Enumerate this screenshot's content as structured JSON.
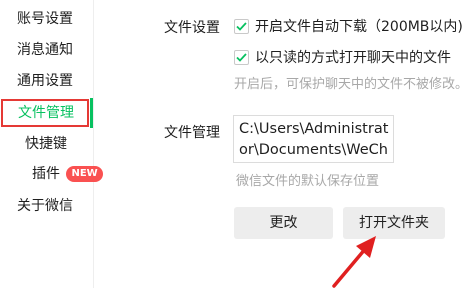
{
  "sidebar": {
    "items": [
      {
        "label": "账号设置"
      },
      {
        "label": "消息通知"
      },
      {
        "label": "通用设置"
      },
      {
        "label": "文件管理",
        "active": true
      },
      {
        "label": "快捷键"
      },
      {
        "label": "插件",
        "badge": "NEW"
      },
      {
        "label": "关于微信"
      }
    ]
  },
  "file_settings": {
    "label": "文件设置",
    "auto_download": {
      "label": "开启文件自动下载（200MB以内)",
      "checked": true
    },
    "read_only": {
      "label": "以只读的方式打开聊天中的文件",
      "checked": true
    },
    "hint": "开启后，可保护聊天中的文件不被修改。"
  },
  "file_management": {
    "label": "文件管理",
    "path": "C:\\Users\\Administrator\\Documents\\WeChat Files\\",
    "hint": "微信文件的默认保存位置"
  },
  "buttons": {
    "change": "更改",
    "open_folder": "打开文件夹"
  },
  "colors": {
    "accent": "#07c160",
    "highlight_box": "#e53935",
    "annotation_arrow": "#e02020",
    "badge": "#fa5151"
  }
}
